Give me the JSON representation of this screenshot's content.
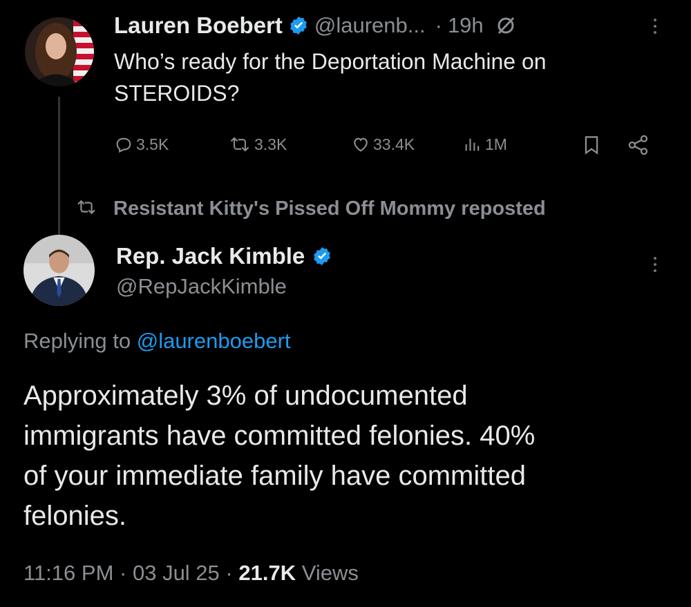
{
  "first_tweet": {
    "author_name": "Lauren Boebert",
    "author_handle": "@laurenb...",
    "dot": "·",
    "time": "19h",
    "text_line1": "Who’s ready for the Deportation Machine on",
    "text_line2": "STEROIDS?",
    "replies": "3.5K",
    "reposts": "3.3K",
    "likes": "33.4K",
    "views": "1M"
  },
  "repost_banner": {
    "text": "Resistant Kitty's Pissed Off Mommy reposted"
  },
  "second_tweet": {
    "author_name": "Rep. Jack Kimble",
    "author_handle": "@RepJackKimble",
    "replying_prefix": "Replying to",
    "replying_handle": "@laurenboebert",
    "text_line1": "Approximately 3% of undocumented",
    "text_line2": "immigrants have committed felonies. 40%",
    "text_line3": "of your immediate family have committed",
    "text_line4": "felonies.",
    "time": "11:16 PM",
    "sep1": "·",
    "date": "03 Jul 25",
    "sep2": "·",
    "views_count": "21.7K",
    "views_label": "Views"
  },
  "colors": {
    "background": "#000000",
    "text": "#e7e9ea",
    "muted": "#8b8f94",
    "link": "#1d9bf0",
    "verified": "#1d9bf0"
  },
  "icons": [
    "verified-badge-icon",
    "grok-icon",
    "more-icon",
    "reply-icon",
    "repost-icon",
    "like-icon",
    "views-icon",
    "bookmark-icon",
    "share-icon"
  ]
}
